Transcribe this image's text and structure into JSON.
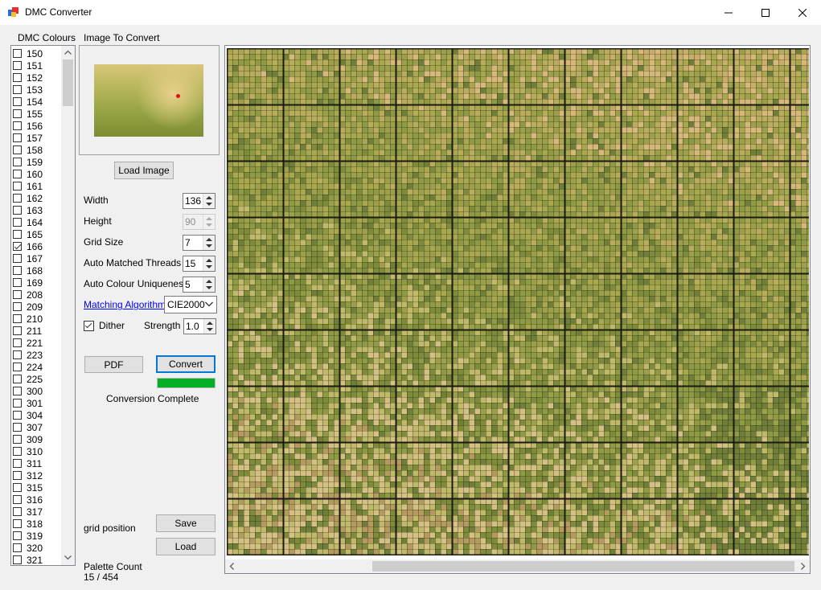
{
  "window": {
    "title": "DMC Converter",
    "icon": "app-icon",
    "controls": [
      "minimize-icon",
      "maximize-icon",
      "close-icon"
    ]
  },
  "dmc_list": {
    "label": "DMC Colours",
    "items": [
      {
        "label": "150",
        "checked": false
      },
      {
        "label": "151",
        "checked": false
      },
      {
        "label": "152",
        "checked": false
      },
      {
        "label": "153",
        "checked": false
      },
      {
        "label": "154",
        "checked": false
      },
      {
        "label": "155",
        "checked": false
      },
      {
        "label": "156",
        "checked": false
      },
      {
        "label": "157",
        "checked": false
      },
      {
        "label": "158",
        "checked": false
      },
      {
        "label": "159",
        "checked": false
      },
      {
        "label": "160",
        "checked": false
      },
      {
        "label": "161",
        "checked": false
      },
      {
        "label": "162",
        "checked": false
      },
      {
        "label": "163",
        "checked": false
      },
      {
        "label": "164",
        "checked": false
      },
      {
        "label": "165",
        "checked": false
      },
      {
        "label": "166",
        "checked": true
      },
      {
        "label": "167",
        "checked": false
      },
      {
        "label": "168",
        "checked": false
      },
      {
        "label": "169",
        "checked": false
      },
      {
        "label": "208",
        "checked": false
      },
      {
        "label": "209",
        "checked": false
      },
      {
        "label": "210",
        "checked": false
      },
      {
        "label": "211",
        "checked": false
      },
      {
        "label": "221",
        "checked": false
      },
      {
        "label": "223",
        "checked": false
      },
      {
        "label": "224",
        "checked": false
      },
      {
        "label": "225",
        "checked": false
      },
      {
        "label": "300",
        "checked": false
      },
      {
        "label": "301",
        "checked": false
      },
      {
        "label": "304",
        "checked": false
      },
      {
        "label": "307",
        "checked": false
      },
      {
        "label": "309",
        "checked": false
      },
      {
        "label": "310",
        "checked": false
      },
      {
        "label": "311",
        "checked": false
      },
      {
        "label": "312",
        "checked": false
      },
      {
        "label": "315",
        "checked": false
      },
      {
        "label": "316",
        "checked": false
      },
      {
        "label": "317",
        "checked": false
      },
      {
        "label": "318",
        "checked": false
      },
      {
        "label": "319",
        "checked": false
      },
      {
        "label": "320",
        "checked": false
      },
      {
        "label": "321",
        "checked": false
      }
    ]
  },
  "image_panel": {
    "label": "Image To Convert",
    "load_button": "Load Image"
  },
  "settings": {
    "width_label": "Width",
    "width_value": "136",
    "height_label": "Height",
    "height_value": "90",
    "grid_size_label": "Grid Size",
    "grid_size_value": "7",
    "auto_threads_label": "Auto Matched Threads",
    "auto_threads_value": "15",
    "auto_uniqueness_label": "Auto Colour Uniqueness",
    "auto_uniqueness_value": "5",
    "algorithm_label": "Matching Algorithm",
    "algorithm_value": "CIE2000",
    "dither_label": "Dither",
    "dither_checked": true,
    "strength_label": "Strength",
    "strength_value": "1.0"
  },
  "actions": {
    "pdf_button": "PDF",
    "convert_button": "Convert",
    "progress_fraction": 1.0,
    "status": "Conversion Complete",
    "grid_position_label": "grid position",
    "save_button": "Save",
    "load_button": "Load"
  },
  "palette": {
    "label": "Palette Count",
    "value": "15 / 454"
  },
  "colors": {
    "progress": "#06b025",
    "link": "#0000ff",
    "focus_border": "#0078d7"
  }
}
